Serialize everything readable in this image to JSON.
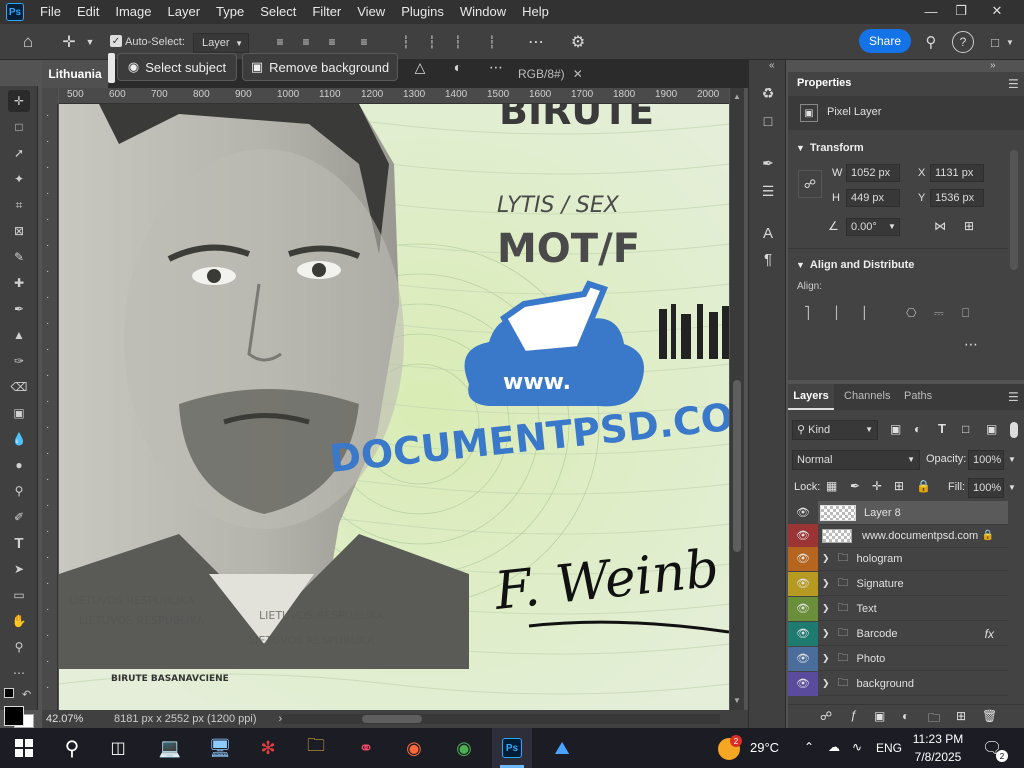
{
  "app": {
    "logo": "Ps",
    "menus": [
      "File",
      "Edit",
      "Image",
      "Layer",
      "Type",
      "Select",
      "Filter",
      "View",
      "Plugins",
      "Window",
      "Help"
    ]
  },
  "options": {
    "auto_select_label": "Auto-Select:",
    "auto_select_target": "Layer",
    "share_label": "Share"
  },
  "context": {
    "select_subject": "Select subject",
    "remove_background": "Remove background"
  },
  "tabs": [
    {
      "label": "Lithuania",
      "active": true
    },
    {
      "label": "RGB/8#)",
      "active": false
    }
  ],
  "ruler": {
    "top": [
      "500",
      "600",
      "700",
      "800",
      "900",
      "1000",
      "1100",
      "1200",
      "1300",
      "1400",
      "1500",
      "1600",
      "1700",
      "1800",
      "1900",
      "2000"
    ]
  },
  "canvas": {
    "surname": "BIRUTE",
    "sex_label": "LYTIS / SEX",
    "sex_value": "MOT/F",
    "website": "www.",
    "brand": "DOCUMENTPSD.CO",
    "signature": "F. Weinb",
    "holder_name": "BIRUTE BASANAVCIENE",
    "micro": "LIETUVOS RESPUBLIKA"
  },
  "status": {
    "zoom": "42.07%",
    "doc_info": "8181 px x 2552 px (1200 ppi)"
  },
  "properties": {
    "title": "Properties",
    "layer_type": "Pixel Layer",
    "transform_label": "Transform",
    "w_label": "W",
    "w": "1052 px",
    "x_label": "X",
    "x": "1131 px",
    "h_label": "H",
    "h": "449 px",
    "y_label": "Y",
    "y": "1536 px",
    "angle": "0.00°",
    "align_label": "Align and Distribute",
    "align_sub": "Align:"
  },
  "layers_panel": {
    "tabs": [
      "Layers",
      "Channels",
      "Paths"
    ],
    "kind": "Kind",
    "blend": "Normal",
    "opacity_label": "Opacity:",
    "opacity": "100%",
    "lock_label": "Lock:",
    "fill_label": "Fill:",
    "fill": "100%"
  },
  "layers": [
    {
      "name": "Layer 8",
      "type": "pixel",
      "color": "#535353",
      "selected": true
    },
    {
      "name": "www.documentpsd.com",
      "type": "pixel",
      "color": "#9b3434",
      "locked": true
    },
    {
      "name": "hologram",
      "type": "group",
      "color": "#b5651d"
    },
    {
      "name": "Signature",
      "type": "group",
      "color": "#b79a22"
    },
    {
      "name": "Text",
      "type": "group",
      "color": "#6b8e3b"
    },
    {
      "name": "Barcode",
      "type": "group",
      "color": "#1f7a70",
      "fx": "fx"
    },
    {
      "name": "Photo",
      "type": "group",
      "color": "#4a6d9c"
    },
    {
      "name": "background",
      "type": "group",
      "color": "#5a4b9c"
    }
  ],
  "taskbar": {
    "weather": "29°C",
    "weather_badge": "2",
    "lang": "ENG",
    "time": "11:23 PM",
    "date": "7/8/2025",
    "notif": "2"
  }
}
